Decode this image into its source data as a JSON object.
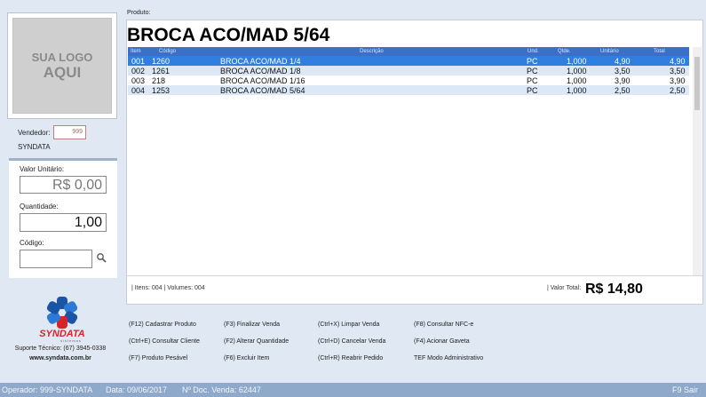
{
  "logo": {
    "line1": "SUA LOGO",
    "line2": "AQUI"
  },
  "vendedor": {
    "label": "Vendedor:",
    "value": "999",
    "name": "SYNDATA"
  },
  "valor_unitario": {
    "label": "Valor Unitário:",
    "value": "R$ 0,00"
  },
  "quantidade": {
    "label": "Quantidade:",
    "value": "1,00"
  },
  "codigo": {
    "label": "Código:",
    "value": ""
  },
  "produto": {
    "label": "Produto:",
    "title": "BROCA ACO/MAD 5/64"
  },
  "grid": {
    "headers": {
      "item": "Item",
      "codigo": "Código",
      "descricao": "Descrição",
      "und": "Und.",
      "qtde": "Qtde.",
      "unitario": "Unitário",
      "total": "Total"
    },
    "rows": [
      {
        "item": "001",
        "codigo": "1260",
        "descricao": "BROCA ACO/MAD 1/4",
        "und": "PC",
        "qtde": "1,000",
        "unitario": "4,90",
        "total": "4,90"
      },
      {
        "item": "002",
        "codigo": "1261",
        "descricao": "BROCA ACO/MAD 1/8",
        "und": "PC",
        "qtde": "1,000",
        "unitario": "3,50",
        "total": "3,50"
      },
      {
        "item": "003",
        "codigo": "218",
        "descricao": "BROCA ACO/MAD 1/16",
        "und": "PC",
        "qtde": "1,000",
        "unitario": "3,90",
        "total": "3,90"
      },
      {
        "item": "004",
        "codigo": "1253",
        "descricao": "BROCA ACO/MAD 5/64",
        "und": "PC",
        "qtde": "1,000",
        "unitario": "2,50",
        "total": "2,50"
      }
    ]
  },
  "totals": {
    "itens_info": "| Itens: 004 | Volumes: 004",
    "valor_total_label": "| Valor Total:",
    "valor_total": "R$ 14,80"
  },
  "brand": {
    "name": "SYNDATA",
    "sub": "sistemas",
    "suporte": "Suporte Técnico: (67) 3945-0338",
    "site": "www.syndata.com.br"
  },
  "shortcuts": {
    "f12": "(F12) Cadastrar Produto",
    "ctrl_e": "(Ctrl+E) Consultar Cliente",
    "f7": "(F7) Produto Pesável",
    "f3": "(F3) Finalizar Venda",
    "f2": "(F2) Alterar Quantidade",
    "f6": "(F6) Excluir Item",
    "ctrl_x": "(Ctrl+X) Limpar Venda",
    "ctrl_d": "(Ctrl+D) Cancelar Venda",
    "ctrl_r": "(Ctrl+R) Reabrir Pedido",
    "f8": "(F8) Consultar NFC-e",
    "f4": "(F4) Acionar Gaveta",
    "tef": "TEF Modo Administrativo"
  },
  "status": {
    "operador": "Operador: 999-SYNDATA",
    "data": "Data: 09/06/2017",
    "doc": "Nº Doc. Venda: 62447",
    "sair": "F9 Sair"
  },
  "colors": {
    "selection": "#2f7fe0",
    "header": "#3c70c8",
    "status_bar": "#8ea9c9",
    "brand_red": "#d8232a",
    "brand_blue": "#1a54a6"
  },
  "icons": {
    "search": "magnifier-icon",
    "brand_logo": "syndata-logo"
  }
}
